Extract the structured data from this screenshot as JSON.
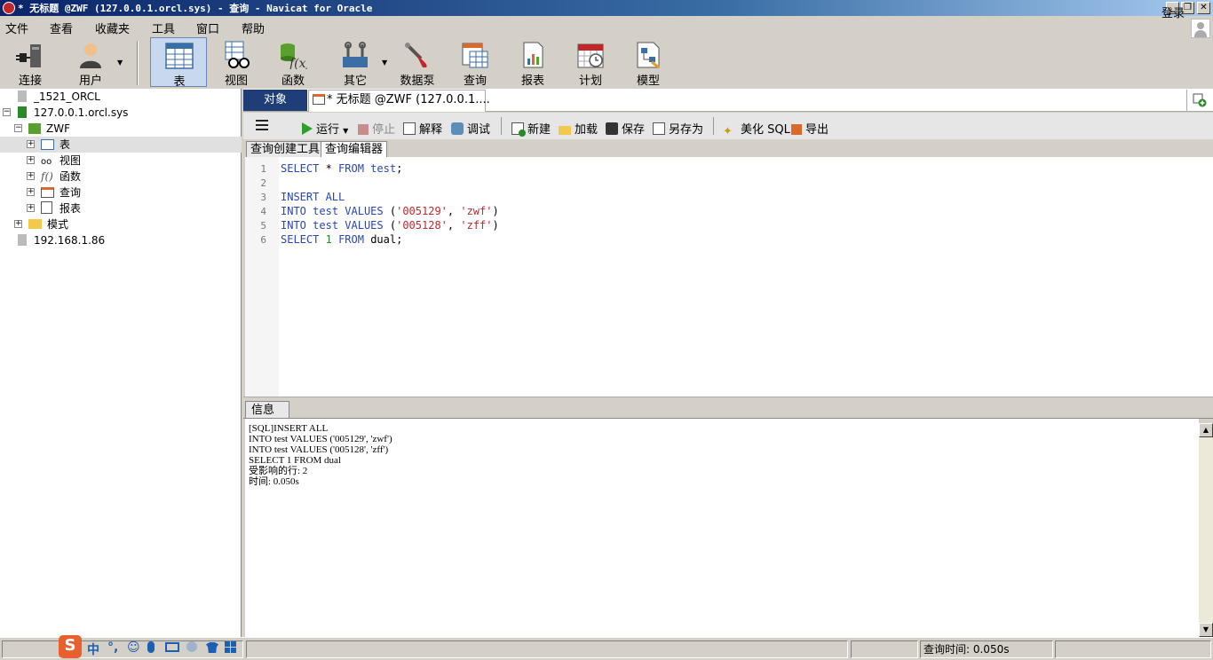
{
  "window": {
    "title": "* 无标题 @ZWF (127.0.0.1.orcl.sys) - 查询 - Navicat for Oracle"
  },
  "menu": [
    "文件",
    "查看",
    "收藏夹",
    "工具",
    "窗口",
    "帮助"
  ],
  "login_label": "登录",
  "toolbar": [
    {
      "label": "连接",
      "icon": "plug-icon"
    },
    {
      "label": "用户",
      "icon": "user-icon"
    },
    {
      "label": "表",
      "icon": "table-icon"
    },
    {
      "label": "视图",
      "icon": "view-glasses-icon"
    },
    {
      "label": "函数",
      "icon": "function-icon"
    },
    {
      "label": "其它",
      "icon": "tools-icon"
    },
    {
      "label": "数据泵",
      "icon": "pump-icon"
    },
    {
      "label": "查询",
      "icon": "query-icon"
    },
    {
      "label": "报表",
      "icon": "report-icon"
    },
    {
      "label": "计划",
      "icon": "calendar-icon"
    },
    {
      "label": "模型",
      "icon": "model-icon"
    }
  ],
  "tree": [
    {
      "label": "_1521_ORCL"
    },
    {
      "label": "127.0.0.1.orcl.sys"
    },
    {
      "label": "ZWF"
    },
    {
      "label": "表"
    },
    {
      "label": "视图"
    },
    {
      "label": "函数"
    },
    {
      "label": "查询"
    },
    {
      "label": "报表"
    },
    {
      "label": "模式"
    },
    {
      "label": "192.168.1.86"
    }
  ],
  "tabs": {
    "objects": "对象",
    "query": "* 无标题 @ZWF (127.0.0.1...."
  },
  "query_toolbar": {
    "menu_icon": "hamburger-icon",
    "run": "运行",
    "stop": "停止",
    "explain": "解释",
    "debug": "调试",
    "new": "新建",
    "load": "加载",
    "save": "保存",
    "save_as": "另存为",
    "beautify": "美化 SQL",
    "export": "导出"
  },
  "sub_tabs": [
    "查询创建工具",
    "查询编辑器"
  ],
  "editor": {
    "line_numbers": [
      "1",
      "2",
      "3",
      "4",
      "5",
      "6"
    ]
  },
  "info_tab": "信息",
  "info_lines": [
    "[SQL]INSERT ALL",
    "INTO test VALUES ('005129', 'zwf')",
    "INTO test VALUES ('005128', 'zff')",
    "SELECT 1 FROM dual",
    "受影响的行: 2",
    "时间: 0.050s"
  ],
  "status": {
    "query_time": "查询时间: 0.050s"
  },
  "ime": {
    "lang": "中"
  },
  "colors": {
    "tab_active": "#1f3e78",
    "keyword": "#2846b7",
    "string": "#c0262a",
    "number": "#2a8a2a",
    "titlebar": "#0a246a"
  }
}
